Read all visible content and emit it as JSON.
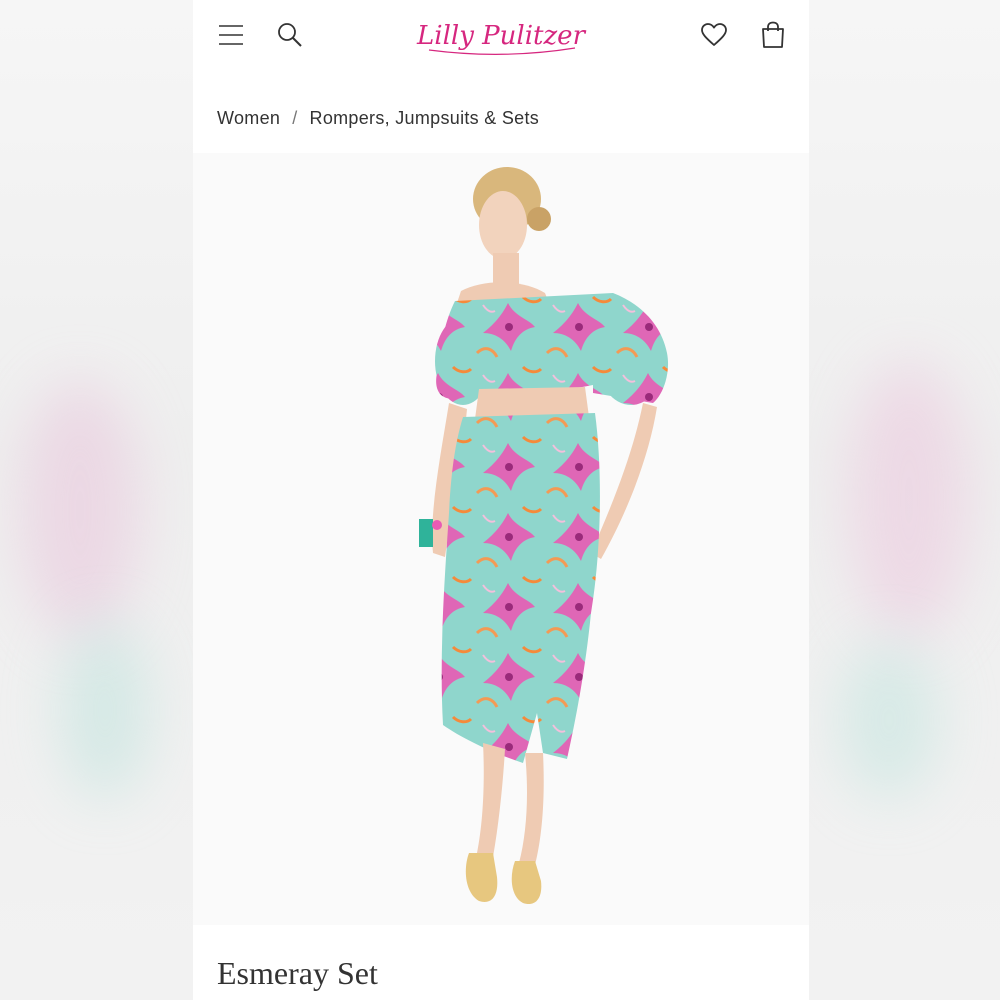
{
  "header": {
    "menu_icon": "hamburger-menu-icon",
    "search_icon": "search-icon",
    "logo_text": "Lilly Pulitzer",
    "wishlist_icon": "heart-icon",
    "bag_icon": "shopping-bag-icon"
  },
  "breadcrumb": {
    "items": [
      "Women",
      "Rompers, Jumpsuits & Sets"
    ],
    "separator": "/"
  },
  "product": {
    "title": "Esmeray Set",
    "image_description_colors": {
      "base": "#8fd6cc",
      "accent_pink": "#e85bb4",
      "accent_orange": "#f39a54"
    }
  },
  "colors": {
    "brand": "#d6277f",
    "text": "#333333",
    "background": "#ffffff"
  }
}
